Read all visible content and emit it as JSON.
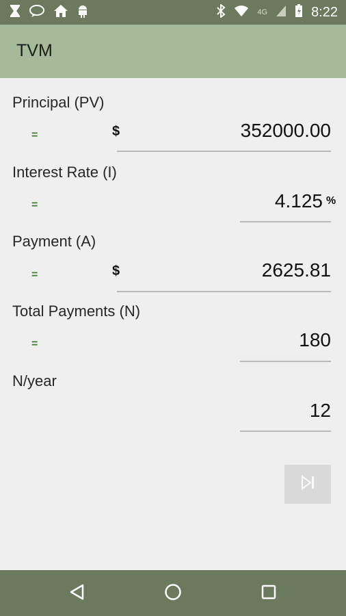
{
  "status_bar": {
    "time": "8:22",
    "network": "4G",
    "left_icons": [
      "hourglass-icon",
      "chat-icon",
      "home-icon",
      "android-icon"
    ],
    "right_icons": [
      "bluetooth-icon",
      "wifi-icon",
      "signal-icon",
      "battery-icon"
    ]
  },
  "app": {
    "title": "TVM"
  },
  "fields": [
    {
      "label": "Principal (PV)",
      "equals": "=",
      "currency": "$",
      "value": "352000.00"
    },
    {
      "label": "Interest Rate (I)",
      "equals": "=",
      "value": "4.125",
      "suffix": "%"
    },
    {
      "label": "Payment (A)",
      "equals": "=",
      "currency": "$",
      "value": "2625.81"
    },
    {
      "label": "Total Payments (N)",
      "equals": "=",
      "value": "180"
    },
    {
      "label": "N/year",
      "value": "12"
    }
  ],
  "actions": {
    "solve_icon": "skip-next-icon"
  },
  "nav_bar": {
    "icons": [
      "back-icon",
      "home-circle-icon",
      "recents-icon"
    ]
  },
  "colors": {
    "status_bar": "#6b7a5c",
    "app_bar": "#a4ba98",
    "background": "#efefef",
    "equals_green": "#3e7d2e"
  }
}
